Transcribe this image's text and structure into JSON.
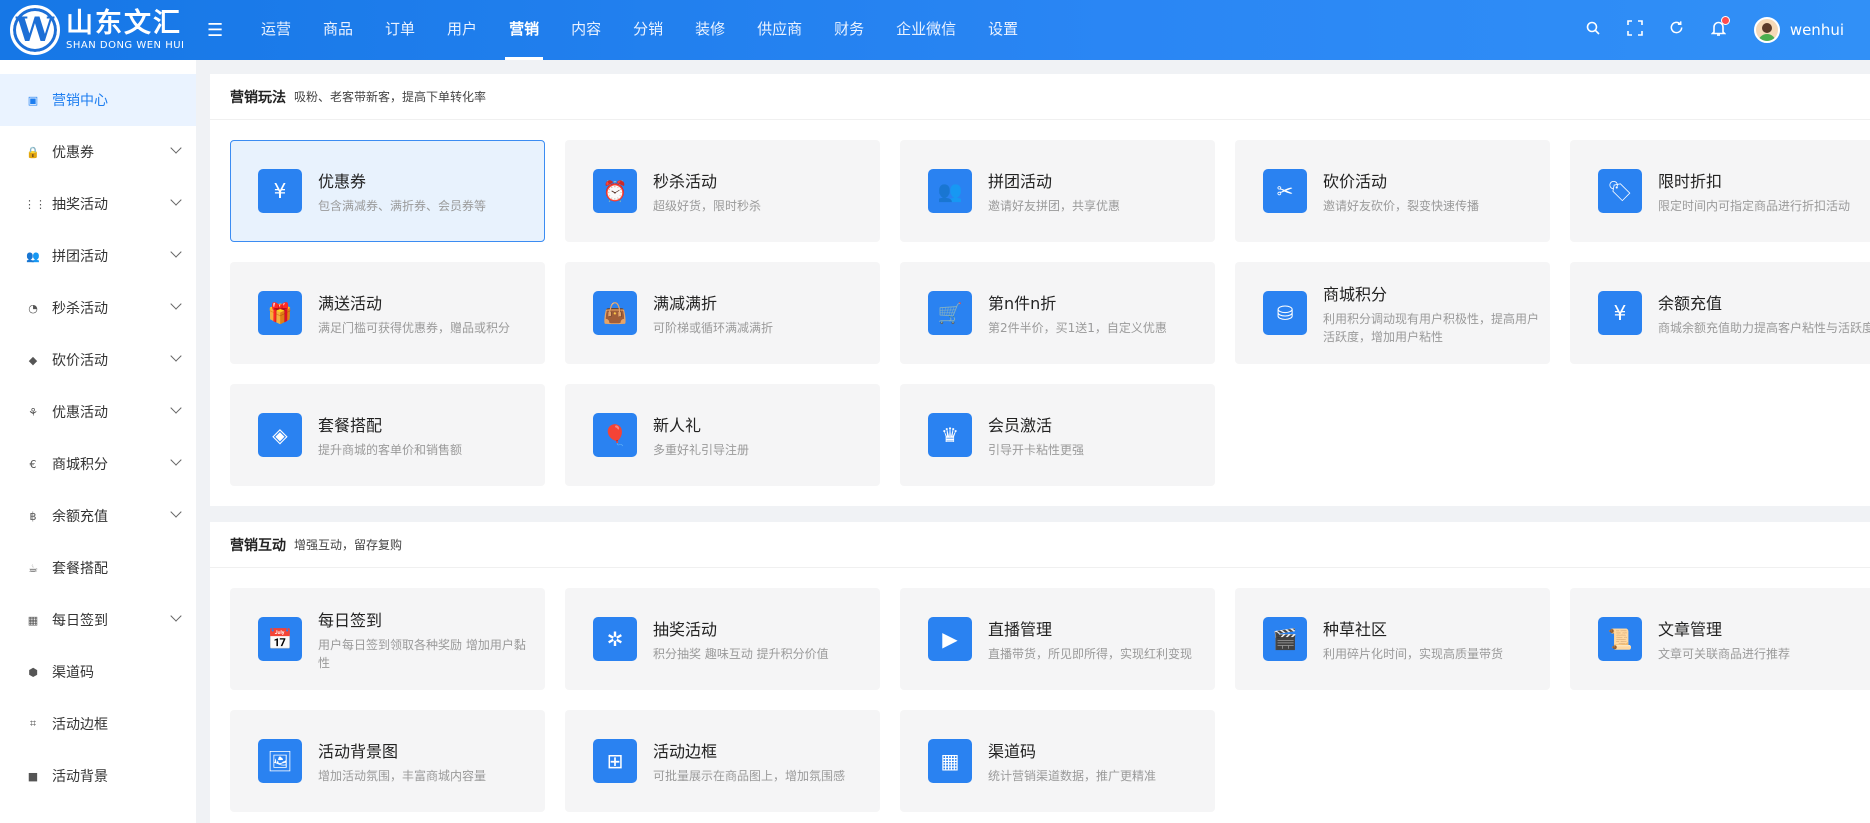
{
  "brand": {
    "logo_letter": "W",
    "name_cn": "山东文汇",
    "name_en": "SHAN DONG WEN HUI"
  },
  "topnav": {
    "items": [
      "运营",
      "商品",
      "订单",
      "用户",
      "营销",
      "内容",
      "分销",
      "装修",
      "供应商",
      "财务",
      "企业微信",
      "设置"
    ],
    "active": "营销"
  },
  "header": {
    "username": "wenhui",
    "icons": [
      "search-icon",
      "fullscreen-icon",
      "refresh-icon",
      "bell-icon"
    ],
    "notification_dot_color": "#ff4d4f"
  },
  "sidebar": {
    "items": [
      {
        "label": "营销中心",
        "icon": "▣",
        "active": true,
        "expandable": false
      },
      {
        "label": "优惠券",
        "icon": "🔒",
        "expandable": true
      },
      {
        "label": "抽奖活动",
        "icon": "⋮⋮",
        "expandable": true
      },
      {
        "label": "拼团活动",
        "icon": "👥",
        "expandable": true
      },
      {
        "label": "秒杀活动",
        "icon": "◔",
        "expandable": true
      },
      {
        "label": "砍价活动",
        "icon": "◆",
        "expandable": true
      },
      {
        "label": "优惠活动",
        "icon": "⚘",
        "expandable": true
      },
      {
        "label": "商城积分",
        "icon": "€",
        "expandable": true
      },
      {
        "label": "余额充值",
        "icon": "฿",
        "expandable": true
      },
      {
        "label": "套餐搭配",
        "icon": "☕",
        "expandable": false
      },
      {
        "label": "每日签到",
        "icon": "▦",
        "expandable": true
      },
      {
        "label": "渠道码",
        "icon": "⬢",
        "expandable": false
      },
      {
        "label": "活动边框",
        "icon": "⌗",
        "expandable": false
      },
      {
        "label": "活动背景",
        "icon": "■",
        "expandable": false
      }
    ]
  },
  "sections": [
    {
      "title": "营销玩法",
      "subtitle": "吸粉、老客带新客，提高下单转化率",
      "cards": [
        {
          "title": "优惠券",
          "desc": "包含满减券、满折券、会员券等",
          "icon": "¥",
          "icon_name": "coupon-icon",
          "selected": true
        },
        {
          "title": "秒杀活动",
          "desc": "超级好货，限时秒杀",
          "icon": "⏰",
          "icon_name": "alarm-icon"
        },
        {
          "title": "拼团活动",
          "desc": "邀请好友拼团，共享优惠",
          "icon": "👥",
          "icon_name": "group-icon"
        },
        {
          "title": "砍价活动",
          "desc": "邀请好友砍价，裂变快速传播",
          "icon": "✂",
          "icon_name": "bargain-icon"
        },
        {
          "title": "限时折扣",
          "desc": "限定时间内可指定商品进行折扣活动",
          "icon": "🏷",
          "icon_name": "discount-tag-icon"
        },
        {
          "title": "满送活动",
          "desc": "满足门槛可获得优惠券，赠品或积分",
          "icon": "🎁",
          "icon_name": "gift-icon"
        },
        {
          "title": "满减满折",
          "desc": "可阶梯或循环满减满折",
          "icon": "👜",
          "icon_name": "bag-icon"
        },
        {
          "title": "第n件n折",
          "desc": "第2件半价，买1送1，自定义优惠",
          "icon": "🛒",
          "icon_name": "cart-icon"
        },
        {
          "title": "商城积分",
          "desc": "利用积分调动现有用户积极性，提高用户活跃度，增加用户粘性",
          "icon": "⛁",
          "icon_name": "points-icon"
        },
        {
          "title": "余额充值",
          "desc": "商城余额充值助力提高客户粘性与活跃度",
          "icon": "¥",
          "icon_name": "money-bag-icon"
        },
        {
          "title": "套餐搭配",
          "desc": "提升商城的客单价和销售额",
          "icon": "◈",
          "icon_name": "package-icon"
        },
        {
          "title": "新人礼",
          "desc": "多重好礼引导注册",
          "icon": "🎈",
          "icon_name": "balloon-icon"
        },
        {
          "title": "会员激活",
          "desc": "引导开卡粘性更强",
          "icon": "♛",
          "icon_name": "crown-icon"
        }
      ]
    },
    {
      "title": "营销互动",
      "subtitle": "增强互动，留存复购",
      "cards": [
        {
          "title": "每日签到",
          "desc": "用户每日签到领取各种奖励 增加用户黏性",
          "icon": "📅",
          "icon_name": "calendar-check-icon"
        },
        {
          "title": "抽奖活动",
          "desc": "积分抽奖 趣味互动 提升积分价值",
          "icon": "✲",
          "icon_name": "lottery-wheel-icon"
        },
        {
          "title": "直播管理",
          "desc": "直播带货，所见即所得，实现红利变现",
          "icon": "▶",
          "icon_name": "live-tv-icon"
        },
        {
          "title": "种草社区",
          "desc": "利用碎片化时间，实现高质量带货",
          "icon": "🎬",
          "icon_name": "video-clapper-icon"
        },
        {
          "title": "文章管理",
          "desc": "文章可关联商品进行推荐",
          "icon": "📜",
          "icon_name": "article-icon"
        },
        {
          "title": "活动背景图",
          "desc": "增加活动氛围，丰富商城内容量",
          "icon": "🖼",
          "icon_name": "image-icon"
        },
        {
          "title": "活动边框",
          "desc": "可批量展示在商品图上，增加氛围感",
          "icon": "⊞",
          "icon_name": "frame-icon"
        },
        {
          "title": "渠道码",
          "desc": "统计营销渠道数据，推广更精准",
          "icon": "▦",
          "icon_name": "qrcode-icon"
        }
      ]
    }
  ],
  "colors": {
    "primary": "#2a82f1",
    "header_bg": "#1677e6",
    "active_sidebar_bg": "#eaf3ff",
    "card_bg": "#f5f5f6",
    "selected_card_bg": "#e8f2fd"
  }
}
